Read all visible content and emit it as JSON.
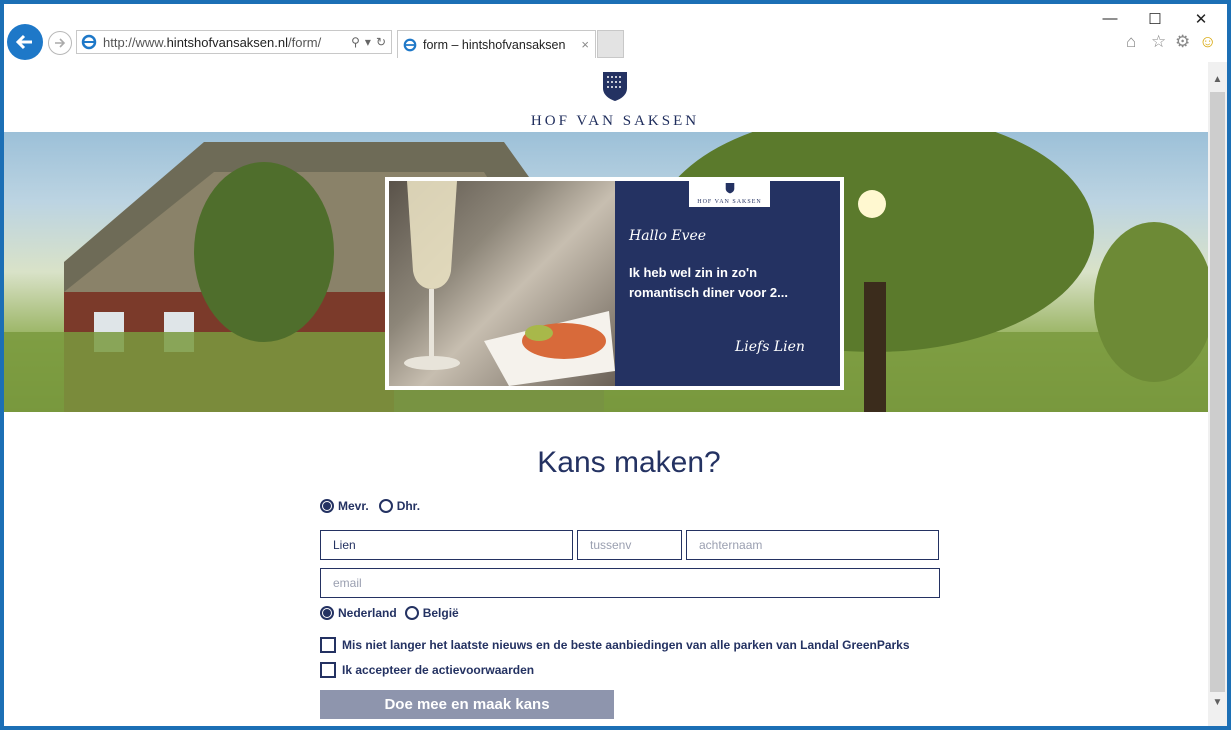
{
  "browser": {
    "url_prefix": "http://www.",
    "url_domain": "hintshofvansaksen.nl",
    "url_path": "/form/",
    "tab_title": "form – hintshofvansaksen",
    "tab_close": "×"
  },
  "site": {
    "brand": "HOF VAN SAKSEN"
  },
  "card": {
    "greeting": "Hallo Evee",
    "message": "Ik heb wel zin in zo'n romantisch diner voor 2...",
    "signature": "Liefs Lien"
  },
  "form": {
    "title": "Kans maken?",
    "salutation_options": [
      "Mevr.",
      "Dhr."
    ],
    "salutation_selected": "Mevr.",
    "first_name_value": "Lien",
    "tussenv_placeholder": "tussenv",
    "lastname_placeholder": "achternaam",
    "email_placeholder": "email",
    "country_options": [
      "Nederland",
      "België"
    ],
    "country_selected": "Nederland",
    "newsletter_label": "Mis niet langer het laatste nieuws en de beste aanbiedingen van alle parken van Landal GreenParks",
    "terms_label": "Ik accepteer de actievoorwaarden",
    "submit_label": "Doe mee en maak kans"
  },
  "colors": {
    "brand_navy": "#243262",
    "button_gray": "#8e95ad",
    "desktop_blue": "#1c6fb5"
  }
}
